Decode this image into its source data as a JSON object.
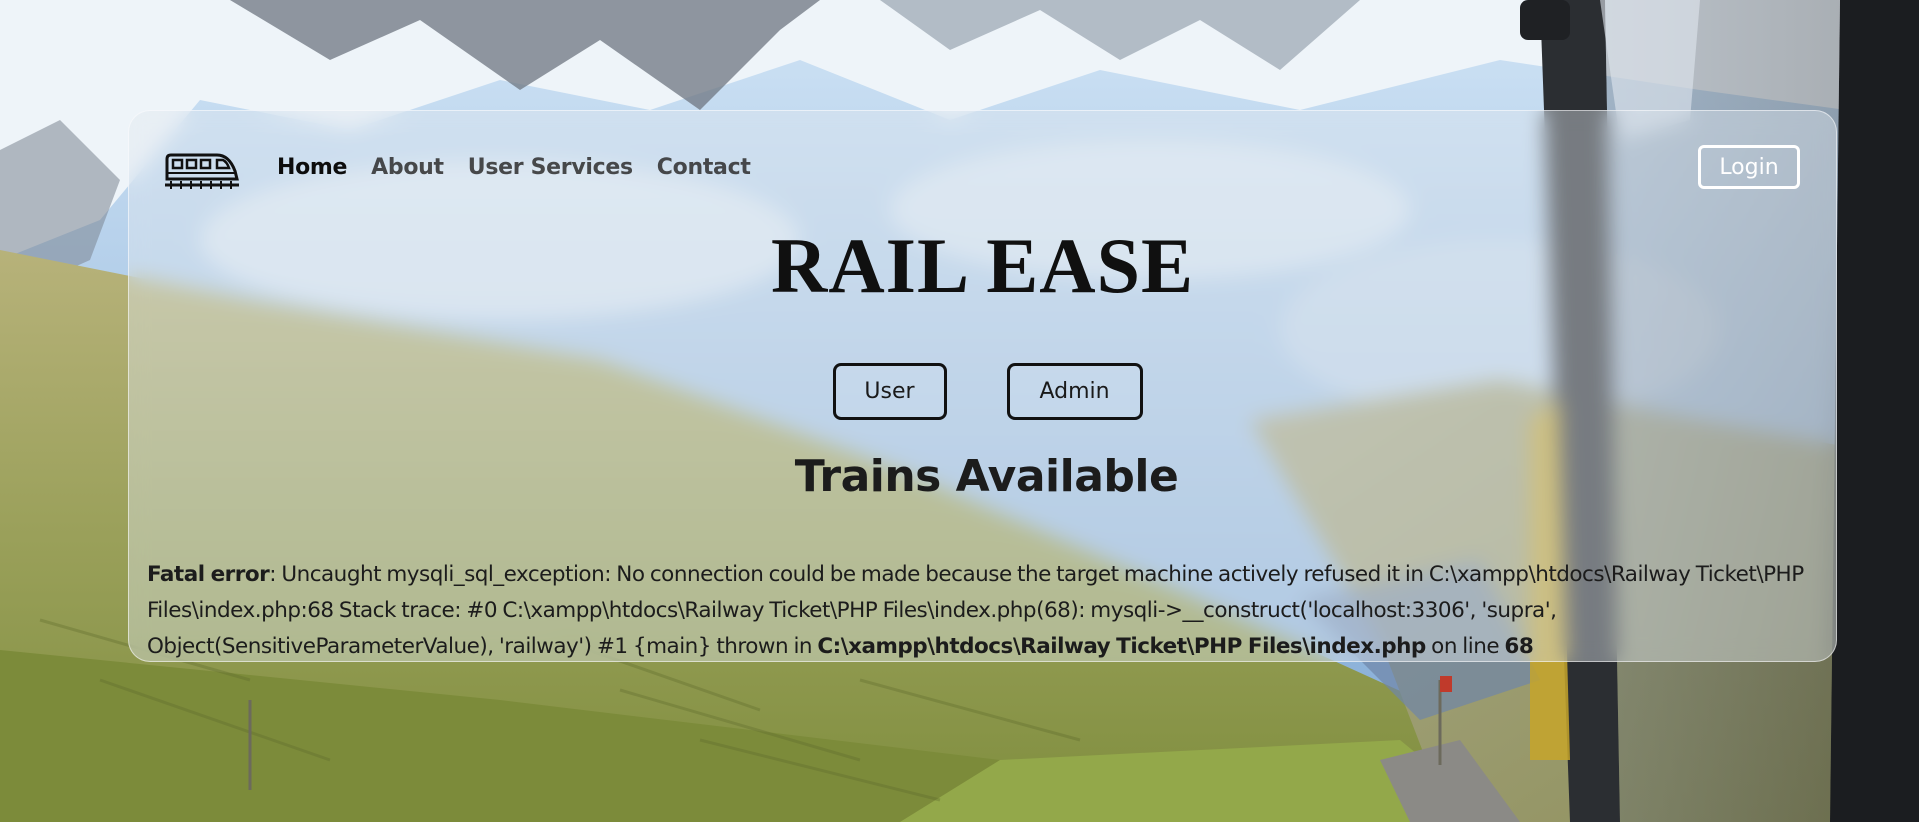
{
  "app": {
    "brand": "RAIL EASE"
  },
  "nav": {
    "items": [
      {
        "label": "Home",
        "active": true
      },
      {
        "label": "About",
        "active": false
      },
      {
        "label": "User Services",
        "active": false
      },
      {
        "label": "Contact",
        "active": false
      }
    ],
    "login_label": "Login",
    "logo_icon": "train-icon"
  },
  "roles": {
    "user_label": "User",
    "admin_label": "Admin"
  },
  "section": {
    "title": "Trains Available"
  },
  "error": {
    "label": "Fatal error",
    "message": ": Uncaught mysqli_sql_exception: No connection could be made because the target machine actively refused it in C:\\xampp\\htdocs\\Railway Ticket\\PHP Files\\index.php:68 Stack trace: #0 C:\\xampp\\htdocs\\Railway Ticket\\PHP Files\\index.php(68): mysqli->__construct('localhost:3306', 'supra', Object(SensitiveParameterValue), 'railway') #1 {main} thrown in ",
    "file": "C:\\xampp\\htdocs\\Railway Ticket\\PHP Files\\index.php",
    "line_text": " on line ",
    "line_number": "68"
  },
  "colors": {
    "glass": "#e1e8ee",
    "text": "#1d1d1d",
    "sky": "#9fc4e6",
    "grass": "#8a9a52"
  }
}
